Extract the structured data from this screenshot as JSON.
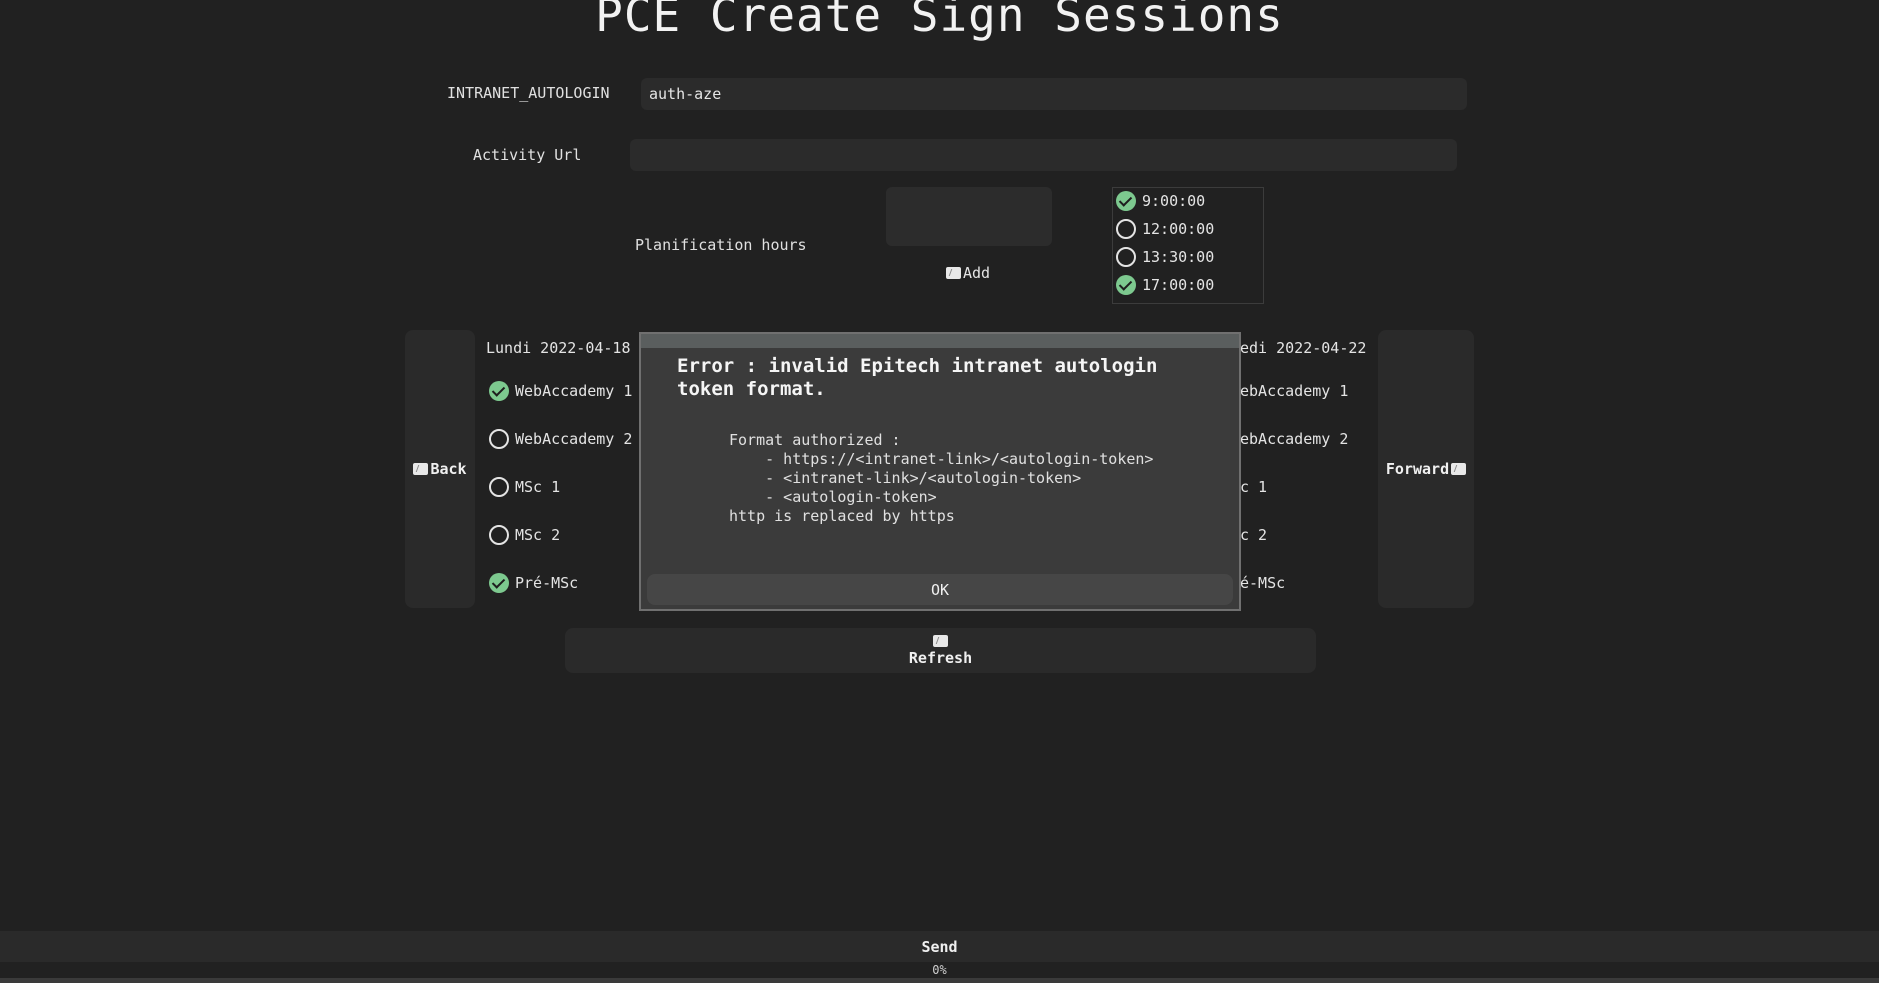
{
  "app": {
    "title": "PCE Create Sign Sessions"
  },
  "form": {
    "autologin_label": "INTRANET_AUTOLOGIN",
    "autologin_value": "auth-aze",
    "activity_label": "Activity Url",
    "activity_value": "",
    "hours_label": "Planification hours",
    "add_label": "Add"
  },
  "hours": [
    {
      "time": "9:00:00",
      "checked": true
    },
    {
      "time": "12:00:00",
      "checked": false
    },
    {
      "time": "13:30:00",
      "checked": false
    },
    {
      "time": "17:00:00",
      "checked": true
    }
  ],
  "nav": {
    "back_label": "Back",
    "forward_label": "Forward"
  },
  "days": {
    "left": {
      "title": "Lundi 2022-04-18",
      "sessions": [
        {
          "name": "WebAccademy 1",
          "checked": true
        },
        {
          "name": "WebAccademy 2",
          "checked": false
        },
        {
          "name": "MSc 1",
          "checked": false
        },
        {
          "name": "MSc 2",
          "checked": false
        },
        {
          "name": "Pré-MSc",
          "checked": true
        }
      ]
    },
    "right": {
      "title": "edi 2022-04-22",
      "sessions": [
        {
          "name": "ebAccademy 1"
        },
        {
          "name": "ebAccademy 2"
        },
        {
          "name": "c 1"
        },
        {
          "name": "c 2"
        },
        {
          "name": "é-MSc"
        }
      ]
    }
  },
  "refresh": {
    "label": "Refresh"
  },
  "dialog": {
    "title": "Error : invalid Epitech intranet autologin token format.",
    "body": "Format authorized :\n    - https://<intranet-link>/<autologin-token>\n    - <intranet-link>/<autologin-token>\n    - <autologin-token>\nhttp is replaced by https",
    "ok_label": "OK"
  },
  "footer": {
    "send_label": "Send",
    "progress_text": "0%",
    "progress_value": 0
  },
  "colors": {
    "background": "#212121",
    "check_green": "#7dc98f",
    "panel": "#2a2a2a"
  },
  "icons": {
    "add": "image-icon",
    "back": "image-icon",
    "forward": "image-icon",
    "refresh": "image-icon",
    "checked": "check-circle-icon",
    "unchecked": "circle-icon"
  }
}
